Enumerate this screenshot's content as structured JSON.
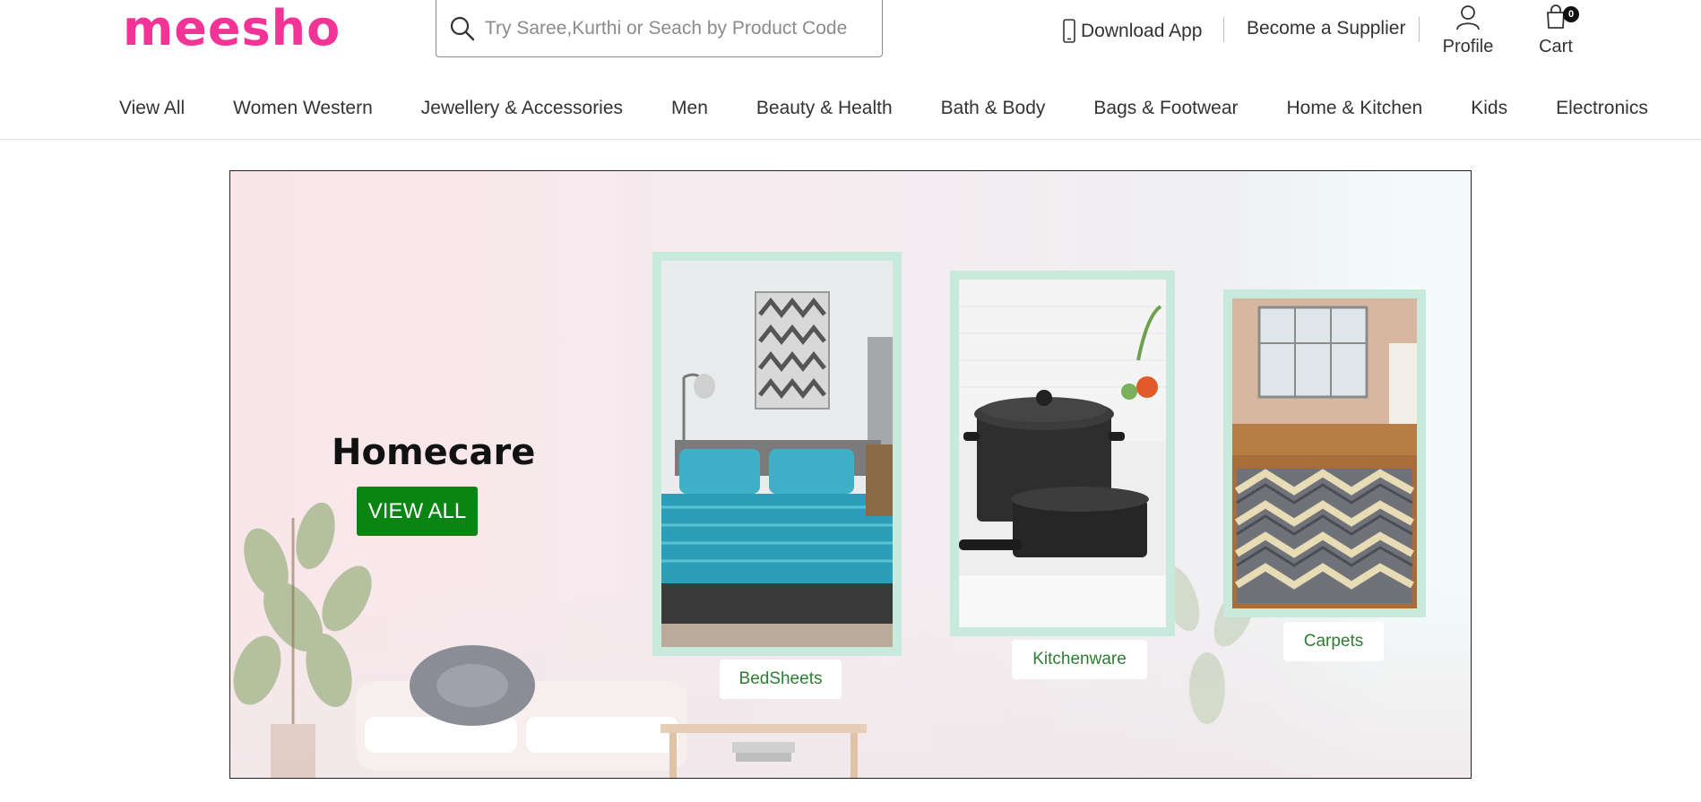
{
  "header": {
    "logo": "meesho",
    "search_placeholder": "Try Saree,Kurthi or Seach by Product Code",
    "download_app": "Download App",
    "become_supplier": "Become a Supplier",
    "profile": "Profile",
    "cart": "Cart",
    "cart_count": "0"
  },
  "nav": {
    "items": [
      "View All",
      "Women Western",
      "Jewellery & Accessories",
      "Men",
      "Beauty & Health",
      "Bath & Body",
      "Bags & Footwear",
      "Home & Kitchen",
      "Kids",
      "Electronics"
    ]
  },
  "banner": {
    "title": "Homecare",
    "view_all": "VIEW ALL",
    "categories": [
      {
        "label": "BedSheets",
        "icon": "bedroom-image"
      },
      {
        "label": "Kitchenware",
        "icon": "cookware-image"
      },
      {
        "label": "Carpets",
        "icon": "carpet-image"
      }
    ]
  },
  "colors": {
    "brand": "#f43397",
    "button": "#0a8514",
    "card_frame": "#c8eadc",
    "chip_text": "#2e7d32"
  }
}
